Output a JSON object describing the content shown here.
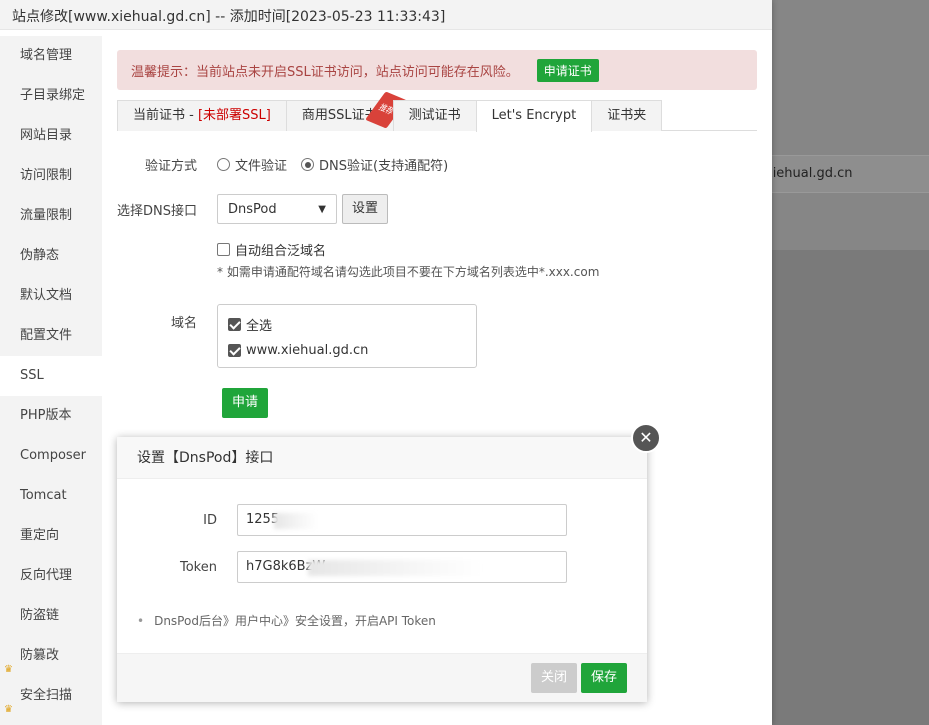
{
  "background": {
    "domain_text": "xiehual.gd.cn"
  },
  "window": {
    "title": "站点修改[www.xiehual.gd.cn] -- 添加时间[2023-05-23 11:33:43]"
  },
  "sidebar": {
    "items": [
      {
        "label": "域名管理"
      },
      {
        "label": "子目录绑定"
      },
      {
        "label": "网站目录"
      },
      {
        "label": "访问限制"
      },
      {
        "label": "流量限制"
      },
      {
        "label": "伪静态"
      },
      {
        "label": "默认文档"
      },
      {
        "label": "配置文件"
      },
      {
        "label": "SSL",
        "active": true
      },
      {
        "label": "PHP版本"
      },
      {
        "label": "Composer"
      },
      {
        "label": "Tomcat"
      },
      {
        "label": "重定向"
      },
      {
        "label": "反向代理"
      },
      {
        "label": "防盗链"
      },
      {
        "label": "防篡改",
        "icon": "crown-icon"
      },
      {
        "label": "安全扫描",
        "icon": "crown-icon"
      }
    ]
  },
  "alert": {
    "text": "温馨提示：当前站点未开启SSL证书访问，站点访问可能存在风险。",
    "button": "申请证书"
  },
  "tabs": {
    "current_prefix": "当前证书 - ",
    "current_status": "[未部署SSL]",
    "commercial": "商用SSL证书",
    "commercial_badge": "推荐",
    "test": "测试证书",
    "letsencrypt": "Let's Encrypt",
    "folder": "证书夹"
  },
  "form": {
    "verify_label": "验证方式",
    "verify_file": "文件验证",
    "verify_dns": "DNS验证(支持通配符)",
    "verify_selected": "dns",
    "dns_label": "选择DNS接口",
    "dns_value": "DnsPod",
    "settings_button": "设置",
    "auto_wildcard": "自动组合泛域名",
    "wildcard_note": "* 如需申请通配符域名请勾选此项目不要在下方域名列表选中*.xxx.com",
    "domain_label": "域名",
    "select_all": "全选",
    "domain_item": "www.xiehual.gd.cn",
    "apply_button": "申请"
  },
  "modal": {
    "title": "设置【DnsPod】接口",
    "id_label": "ID",
    "id_value": "1255",
    "token_label": "Token",
    "token_value": "h7G8k6BzW",
    "tip": "DnsPod后台》用户中心》安全设置，开启API Token",
    "close_button": "关闭",
    "save_button": "保存"
  },
  "colors": {
    "accent": "#20a53a",
    "alert_bg": "#f2dede",
    "alert_text": "#a94442",
    "danger_text": "#cc0000"
  }
}
